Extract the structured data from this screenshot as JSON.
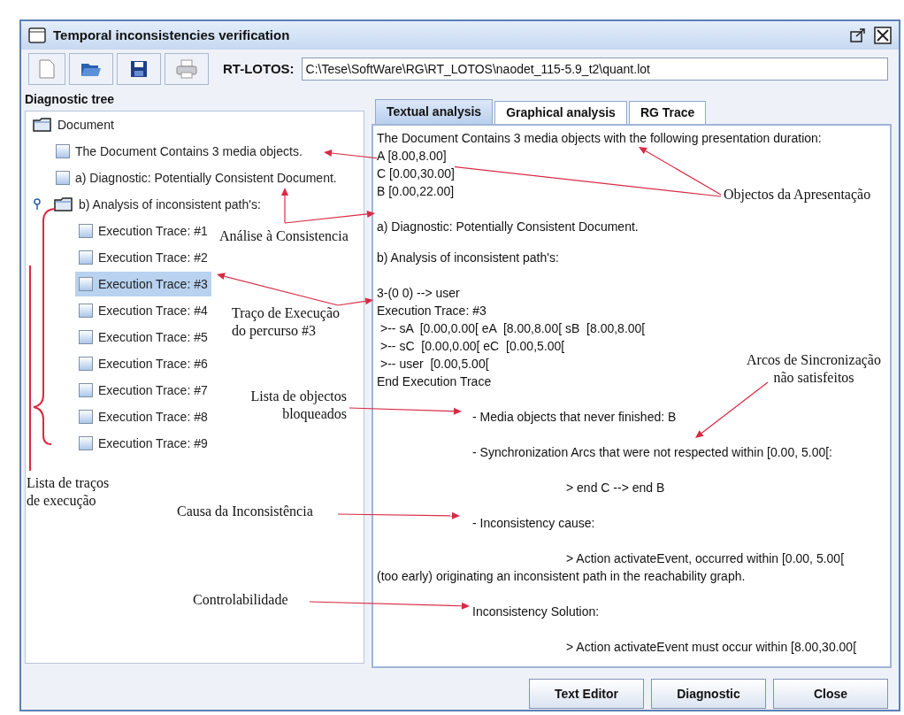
{
  "window": {
    "title": "Temporal inconsistencies verification"
  },
  "toolbar": {
    "label": "RT-LOTOS:",
    "path": "C:\\Tese\\SoftWare\\RG\\RT_LOTOS\\naodet_115-5.9_t2\\quant.lot"
  },
  "tree": {
    "title": "Diagnostic tree",
    "root": {
      "label": "Document",
      "selected": false,
      "children": [
        {
          "label": "The Document Contains 3 media objects.",
          "selected": false
        },
        {
          "label": "a) Diagnostic: Potentially Consistent Document.",
          "selected": false
        },
        {
          "label": "b) Analysis of inconsistent path's:",
          "expanded": true,
          "selected": false,
          "children": [
            {
              "label": "Execution Trace: #1",
              "selected": false
            },
            {
              "label": "Execution Trace: #2",
              "selected": false
            },
            {
              "label": "Execution Trace: #3",
              "selected": true
            },
            {
              "label": "Execution Trace: #4",
              "selected": false
            },
            {
              "label": "Execution Trace: #5",
              "selected": false
            },
            {
              "label": "Execution Trace: #6",
              "selected": false
            },
            {
              "label": "Execution Trace: #7",
              "selected": false
            },
            {
              "label": "Execution Trace: #8",
              "selected": false
            },
            {
              "label": "Execution Trace: #9",
              "selected": false
            }
          ]
        }
      ]
    }
  },
  "tabs": [
    {
      "label": "Textual analysis",
      "selected": true
    },
    {
      "label": "Graphical analysis",
      "selected": false
    },
    {
      "label": "RG Trace",
      "selected": false
    }
  ],
  "text_paragraphs": [
    [
      {
        "kind": "plain",
        "text": "The Document Contains 3 media objects with the following presentation duration:"
      },
      {
        "kind": "plain",
        "text": "A [8.00,8.00]"
      },
      {
        "kind": "plain",
        "text": "C [0.00,30.00]"
      },
      {
        "kind": "plain",
        "text": "B [0.00,22.00]"
      }
    ],
    [
      {
        "kind": "plain",
        "text": "a) Diagnostic: Potentially Consistent Document."
      }
    ],
    [
      {
        "kind": "plain",
        "text": "b) Analysis of inconsistent path's:"
      }
    ],
    [
      {
        "kind": "plain",
        "text": "3-(0 0) --> user"
      },
      {
        "kind": "plain",
        "text": "Execution Trace: #3"
      },
      {
        "kind": "step",
        "text": ">-- sA  [0.00,0.00[ eA  [8.00,8.00[ sB  [8.00,8.00["
      },
      {
        "kind": "step",
        "text": ">-- sC  [0.00,0.00[ eC  [0.00,5.00["
      },
      {
        "kind": "step",
        "text": ">-- user  [0.00,5.00["
      },
      {
        "kind": "plain",
        "text": "End Execution Trace"
      }
    ],
    [
      {
        "kind": "item",
        "text": "- Media objects that never finished: B"
      }
    ],
    [
      {
        "kind": "item",
        "text": "- Synchronization Arcs that were not respected within [0.00, 5.00[:"
      }
    ],
    [
      {
        "kind": "detail",
        "text": "> end C --> end B"
      }
    ],
    [
      {
        "kind": "item",
        "text": "- Inconsistency cause:"
      }
    ],
    [
      {
        "kind": "detail",
        "text": "> Action activateEvent, occurred within [0.00, 5.00["
      },
      {
        "kind": "plain",
        "text": "(too early) originating an inconsistent path in the reachability graph."
      }
    ],
    [
      {
        "kind": "item",
        "text": "Inconsistency Solution:"
      }
    ],
    [
      {
        "kind": "detail",
        "text": "> Action activateEvent must occur within [8.00,30.00["
      }
    ]
  ],
  "buttons": [
    "Text Editor",
    "Diagnostic",
    "Close"
  ],
  "annotations": [
    {
      "lines": [
        "Objectos da Apresentação"
      ]
    },
    {
      "lines": [
        "Análise à Consistencia"
      ]
    },
    {
      "lines": [
        "Traço de Execução",
        "do percurso #3"
      ]
    },
    {
      "lines": [
        "Lista de objectos",
        "bloqueados"
      ]
    },
    {
      "lines": [
        "Arcos de Sincronização",
        "não satisfeitos"
      ]
    },
    {
      "lines": [
        "Causa da Inconsistência"
      ]
    },
    {
      "lines": [
        "Controlabilidade"
      ]
    },
    {
      "lines": [
        "Lista de traços",
        "de execução"
      ]
    }
  ]
}
